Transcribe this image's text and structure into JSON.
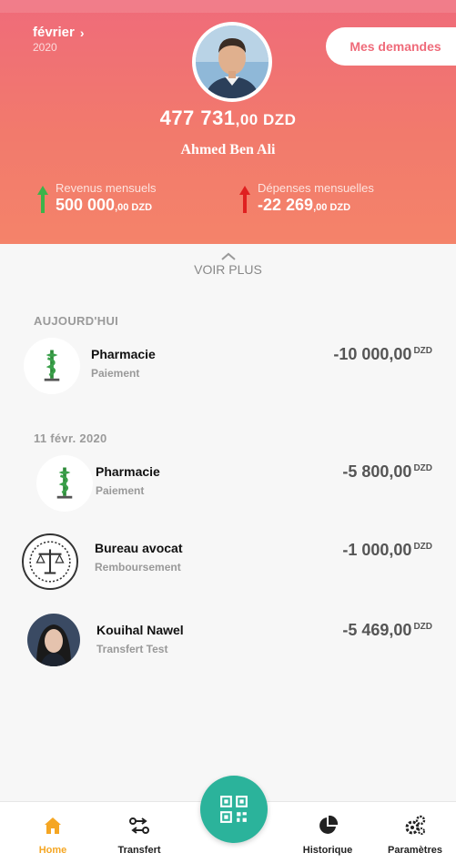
{
  "header": {
    "month": "février",
    "year": "2020",
    "requests_button": "Mes demandes",
    "balance_main": "477 731",
    "balance_decimal": ",00 DZD",
    "user_name": "Ahmed Ben Ali",
    "revenue": {
      "label": "Revenus mensuels",
      "value": "500 000",
      "decimal": ",00 DZD"
    },
    "expenses": {
      "label": "Dépenses mensuelles",
      "value": "-22 269",
      "decimal": ",00 DZD"
    },
    "colors": {
      "gradient_top": "#ef6b7a",
      "gradient_bottom": "#f4836a",
      "revenue_arrow": "#3cb34a",
      "expense_arrow": "#e02020"
    }
  },
  "content": {
    "see_more": "VOIR PLUS",
    "sections": [
      {
        "title": "AUJOURD'HUI",
        "items": [
          {
            "title": "Pharmacie",
            "subtitle": "Paiement",
            "amount": "-10 000,00",
            "currency": "DZD",
            "icon": "pharmacy-logo-icon"
          }
        ]
      },
      {
        "title": "11 févr. 2020",
        "items": [
          {
            "title": "Pharmacie",
            "subtitle": "Paiement",
            "amount": "-5 800,00",
            "currency": "DZD",
            "icon": "pharmacy-logo-icon"
          },
          {
            "title": "Bureau avocat",
            "subtitle": "Remboursement",
            "amount": "-1 000,00",
            "currency": "DZD",
            "icon": "scales-of-justice-icon"
          },
          {
            "title": "Kouihal Nawel",
            "subtitle": "Transfert Test",
            "amount": "-5 469,00",
            "currency": "DZD",
            "icon": "user-avatar-icon"
          }
        ]
      }
    ]
  },
  "bottom_nav": {
    "items": [
      {
        "label": "Home",
        "icon": "home-icon",
        "active": true
      },
      {
        "label": "Transfert",
        "icon": "transfer-icon"
      },
      {
        "label": "Historique",
        "icon": "pie-chart-icon"
      },
      {
        "label": "Paramètres",
        "icon": "gears-icon"
      }
    ],
    "center_button": {
      "icon": "qr-code-icon",
      "color": "#2bb39b"
    },
    "active_color": "#f5a623"
  }
}
